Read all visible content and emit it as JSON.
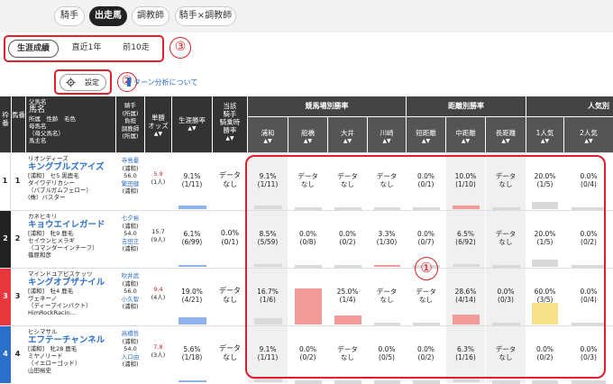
{
  "top_tabs": [
    "騎手",
    "出走馬",
    "調教師",
    "騎手×調教師"
  ],
  "active_tab": "出走馬",
  "sub_tabs": [
    "生涯成績",
    "直近1年",
    "前10走"
  ],
  "active_sub_tab": "生涯成績",
  "annotations": [
    "①",
    "②",
    "③"
  ],
  "settings_label": "設定",
  "turn_link": "ターン分析について",
  "headers": {
    "waku": "枠番",
    "uma": "馬番",
    "horse_info": [
      "父馬名",
      "馬名",
      "所属　性齢　毛色",
      "母馬名",
      "（母父馬名）",
      "馬主名"
    ],
    "jockey": [
      "騎手",
      "(所属)",
      "負担",
      "調教師",
      "(所属)"
    ],
    "odds": [
      "単勝",
      "オッズ"
    ],
    "career_rate": "生涯勝率",
    "jockey_rate": [
      "当該",
      "騎手",
      "騎乗時",
      "勝率"
    ],
    "venue_group": "競馬場別勝率",
    "venues": [
      "浦和",
      "船橋",
      "大井",
      "川崎"
    ],
    "distance_group": "距離別勝率",
    "distances": [
      "短距離",
      "中距離",
      "長距離"
    ],
    "pop_group": "人気別",
    "pops": [
      "1人気",
      "2人気"
    ]
  },
  "rows": [
    {
      "waku": "1",
      "uma": "1",
      "waku_color": "#ffffff",
      "waku_text": "#222222",
      "sire": "リオンディーズ",
      "name": "キングブルズアイズ",
      "detail": "[浦和]　セ5 黒鹿毛",
      "dam": "ダイワデリカシー",
      "damsire": "（バブルガムフェロー）",
      "owner": "(株）バスター",
      "jockey": "寺島憂",
      "jockey_aff": "(浦和)",
      "weight": "56.0",
      "trainer": "繁田健",
      "trainer_aff": "(浦和)",
      "odds": "5.9",
      "odds_pop": "(1人)",
      "odds_red": true,
      "career": [
        "9.1%",
        "(1/11)"
      ],
      "career_bar": 0.091,
      "jrate": [
        "データ",
        "なし"
      ],
      "venues": [
        [
          "9.1%",
          "(1/11)",
          0.091,
          true
        ],
        [
          "データ",
          "なし",
          0,
          false
        ],
        [
          "データ",
          "なし",
          0,
          false
        ],
        [
          "データ",
          "なし",
          0,
          false
        ]
      ],
      "distances": [
        [
          "0.0%",
          "(0/1)",
          0,
          false
        ],
        [
          "10.0%",
          "(1/10)",
          0.1,
          true
        ],
        [
          "データ",
          "なし",
          0,
          true
        ]
      ],
      "pops": [
        [
          "20.0%",
          "(1/5)",
          0.2
        ],
        [
          "0.0%",
          "(0/4)",
          0
        ]
      ]
    },
    {
      "waku": "2",
      "uma": "2",
      "waku_color": "#222222",
      "waku_text": "#ffffff",
      "sire": "カネヒキリ",
      "name": "キョウエイレガード",
      "detail": "[浦和]　牝9 鹿毛",
      "dam": "セイウンヒメラギ",
      "damsire": "（コマンダーインチーフ）",
      "owner": "篠原和彦",
      "jockey": "七夕裕",
      "jockey_aff": "(浦和)",
      "weight": "54.0",
      "trainer": "吉田正",
      "trainer_aff": "(浦和)",
      "odds": "15.7",
      "odds_pop": "(9人)",
      "odds_red": false,
      "career": [
        "6.1%",
        "(6/99)"
      ],
      "career_bar": 0.061,
      "jrate": [
        "0.0%",
        "(0/1)"
      ],
      "venues": [
        [
          "8.5%",
          "(5/59)",
          0.085,
          true
        ],
        [
          "0.0%",
          "(0/8)",
          0,
          false
        ],
        [
          "0.0%",
          "(0/2)",
          0,
          false
        ],
        [
          "3.3%",
          "(1/30)",
          0.033,
          false
        ]
      ],
      "distances": [
        [
          "0.0%",
          "(0/7)",
          0,
          false
        ],
        [
          "6.5%",
          "(6/92)",
          0.065,
          true
        ],
        [
          "データ",
          "なし",
          0,
          true
        ]
      ],
      "pops": [
        [
          "20.0%",
          "(1/5)",
          0.2
        ],
        [
          "0.0%",
          "(0/2)",
          0
        ]
      ]
    },
    {
      "waku": "3",
      "uma": "3",
      "waku_color": "#e8383d",
      "waku_text": "#ffffff",
      "sire": "マインドユアビスケッツ",
      "name": "キングオブザナイル",
      "detail": "[浦和]　牡4 鹿毛",
      "dam": "ヴェネーノ",
      "damsire": "（ディープインパクト）",
      "owner": "HimRockRacin…",
      "jockey": "吹井武",
      "jockey_aff": "(浦和)",
      "weight": "56.0",
      "trainer": "小久智",
      "trainer_aff": "(浦和)",
      "odds": "9.4",
      "odds_pop": "(4人)",
      "odds_red": true,
      "career": [
        "19.0%",
        "(4/21)"
      ],
      "career_bar": 0.19,
      "jrate": [
        "データ",
        "なし"
      ],
      "venues": [
        [
          "16.7%",
          "(1/6)",
          0.167,
          true
        ],
        [
          "100.0%",
          "(1/1)",
          1.0,
          false
        ],
        [
          "25.0%",
          "(1/4)",
          0.25,
          false
        ],
        [
          "データ",
          "なし",
          0,
          false
        ]
      ],
      "distances": [
        [
          "データ",
          "なし",
          0,
          false
        ],
        [
          "28.6%",
          "(4/14)",
          0.286,
          true
        ],
        [
          "0.0%",
          "(0/3)",
          0,
          true
        ]
      ],
      "pops": [
        [
          "60.0%",
          "(3/5)",
          0.6
        ],
        [
          "0.0%",
          "(0/4)",
          0
        ]
      ]
    },
    {
      "waku": "4",
      "uma": "4",
      "waku_color": "#2a6fc9",
      "waku_text": "#ffffff",
      "sire": "ヒシマサル",
      "name": "エフテーチャンネル",
      "detail": "[浦和]　牝28 鹿毛",
      "dam": "ミヤノリード",
      "damsire": "（イエローゴッド）",
      "owner": "山田裕史",
      "jockey": "高橋哲",
      "jockey_aff": "(浦和)",
      "weight": "54.0",
      "trainer": "入口由",
      "trainer_aff": "(浦和)",
      "odds": "7.8",
      "odds_pop": "(3人)",
      "odds_red": true,
      "career": [
        "5.6%",
        "(1/18)"
      ],
      "career_bar": 0.056,
      "jrate": [
        "データ",
        "なし"
      ],
      "venues": [
        [
          "9.1%",
          "(1/11)",
          0.091,
          true
        ],
        [
          "0.0%",
          "(0/2)",
          0,
          false
        ],
        [
          "データ",
          "なし",
          0,
          false
        ],
        [
          "0.0%",
          "(0/5)",
          0,
          false
        ]
      ],
      "distances": [
        [
          "0.0%",
          "(0/2)",
          0,
          false
        ],
        [
          "6.3%",
          "(1/16)",
          0.063,
          true
        ],
        [
          "データ",
          "なし",
          0,
          true
        ]
      ],
      "pops": [
        [
          "0.0%",
          "(0/2)",
          0
        ],
        [
          "0.0%",
          "(0/3)",
          0
        ]
      ]
    }
  ],
  "colors": {
    "accent": "#2a6fc9",
    "highlight": "#e0202a",
    "bar_gray": "#d9d9d9",
    "bar_blue": "#8fb3ea",
    "bar_red": "#f29a9a",
    "bar_yellow": "#f7e28a",
    "odds_red": "#d0202a"
  }
}
